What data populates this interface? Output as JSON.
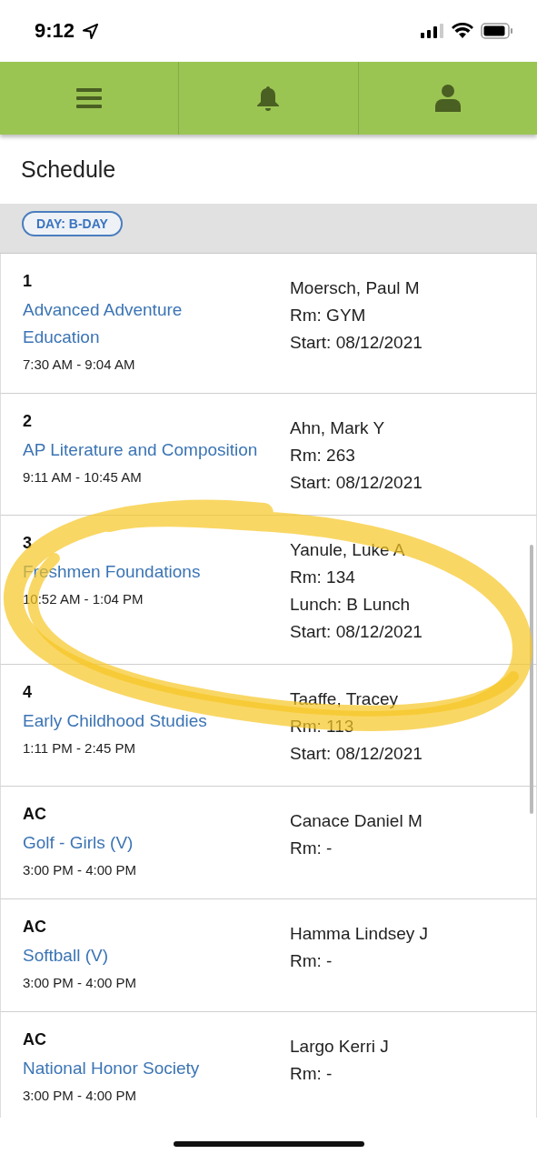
{
  "status_bar": {
    "time": "9:12"
  },
  "nav": {
    "items": [
      {
        "kind": "menu"
      },
      {
        "kind": "bell"
      },
      {
        "kind": "user"
      }
    ]
  },
  "page": {
    "title": "Schedule"
  },
  "day_badge": "DAY: B-DAY",
  "classes": [
    {
      "period": "1",
      "course": "Advanced Adventure Education",
      "time": "7:30 AM - 9:04 AM",
      "details": [
        "Moersch, Paul M",
        "Rm: GYM",
        "Start: 08/12/2021"
      ]
    },
    {
      "period": "2",
      "course": "AP Literature and Composition",
      "time": "9:11 AM - 10:45 AM",
      "details": [
        "Ahn, Mark Y",
        "Rm: 263",
        "Start: 08/12/2021"
      ]
    },
    {
      "period": "3",
      "course": "Freshmen Foundations",
      "time": "10:52 AM - 1:04 PM",
      "details": [
        "Yanule, Luke A",
        "Rm: 134",
        "Lunch: B Lunch",
        "Start: 08/12/2021"
      ]
    },
    {
      "period": "4",
      "course": "Early Childhood Studies",
      "time": "1:11 PM - 2:45 PM",
      "details": [
        "Taaffe, Tracey",
        "Rm: 113",
        "Start: 08/12/2021"
      ]
    },
    {
      "period": "AC",
      "course": "Golf - Girls (V)",
      "time": "3:00 PM - 4:00 PM",
      "details": [
        "Canace Daniel M",
        "Rm: -"
      ]
    },
    {
      "period": "AC",
      "course": "Softball (V)",
      "time": "3:00 PM - 4:00 PM",
      "details": [
        "Hamma Lindsey J",
        "Rm: -"
      ]
    },
    {
      "period": "AC",
      "course": "National Honor Society",
      "time": "3:00 PM - 4:00 PM",
      "details": [
        "Largo Kerri J",
        "Rm: -"
      ]
    }
  ]
}
